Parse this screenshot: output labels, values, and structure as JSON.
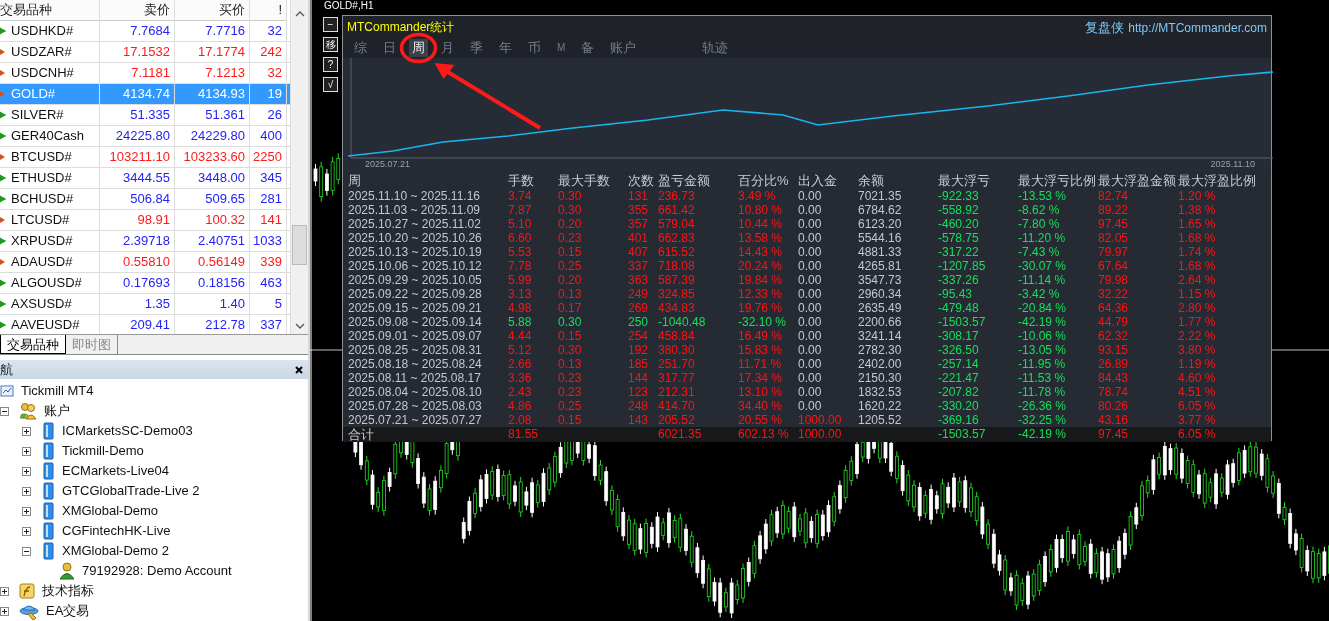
{
  "market_watch": {
    "columns": [
      "交易品种",
      "卖价",
      "买价",
      "!"
    ],
    "rows": [
      {
        "symbol": "USDHKD#",
        "bid": "7.7684",
        "ask": "7.7716",
        "spread": "32",
        "up": true,
        "selected": false
      },
      {
        "symbol": "USDZAR#",
        "bid": "17.1532",
        "ask": "17.1774",
        "spread": "242",
        "up": false,
        "selected": false
      },
      {
        "symbol": "USDCNH#",
        "bid": "7.1181",
        "ask": "7.1213",
        "spread": "32",
        "up": false,
        "selected": false
      },
      {
        "symbol": "GOLD#",
        "bid": "4134.74",
        "ask": "4134.93",
        "spread": "19",
        "up": false,
        "selected": true
      },
      {
        "symbol": "SILVER#",
        "bid": "51.335",
        "ask": "51.361",
        "spread": "26",
        "up": true,
        "selected": false
      },
      {
        "symbol": "GER40Cash",
        "bid": "24225.80",
        "ask": "24229.80",
        "spread": "400",
        "up": true,
        "selected": false
      },
      {
        "symbol": "BTCUSD#",
        "bid": "103211.10",
        "ask": "103233.60",
        "spread": "2250",
        "up": false,
        "selected": false
      },
      {
        "symbol": "ETHUSD#",
        "bid": "3444.55",
        "ask": "3448.00",
        "spread": "345",
        "up": true,
        "selected": false
      },
      {
        "symbol": "BCHUSD#",
        "bid": "506.84",
        "ask": "509.65",
        "spread": "281",
        "up": true,
        "selected": false
      },
      {
        "symbol": "LTCUSD#",
        "bid": "98.91",
        "ask": "100.32",
        "spread": "141",
        "up": false,
        "selected": false
      },
      {
        "symbol": "XRPUSD#",
        "bid": "2.39718",
        "ask": "2.40751",
        "spread": "1033",
        "up": true,
        "selected": false
      },
      {
        "symbol": "ADAUSD#",
        "bid": "0.55810",
        "ask": "0.56149",
        "spread": "339",
        "up": false,
        "selected": false
      },
      {
        "symbol": "ALGOUSD#",
        "bid": "0.17693",
        "ask": "0.18156",
        "spread": "463",
        "up": true,
        "selected": false
      },
      {
        "symbol": "AXSUSD#",
        "bid": "1.35",
        "ask": "1.40",
        "spread": "5",
        "up": true,
        "selected": false
      },
      {
        "symbol": "AAVEUSD#",
        "bid": "209.41",
        "ask": "212.78",
        "spread": "337",
        "up": true,
        "selected": false
      }
    ]
  },
  "market_tabs": [
    {
      "label": "交易品种",
      "selected": true
    },
    {
      "label": "即时图",
      "selected": false
    }
  ],
  "navigator": {
    "title": "航",
    "tree": [
      {
        "label": "Tickmill MT4",
        "kind": "terminal",
        "children": [
          {
            "label": "账户",
            "kind": "accounts",
            "expanded": true,
            "children": [
              {
                "label": "ICMarketsSC-Demo03",
                "kind": "server",
                "expanded": false
              },
              {
                "label": "Tickmill-Demo",
                "kind": "server",
                "expanded": false
              },
              {
                "label": "ECMarkets-Live04",
                "kind": "server",
                "expanded": false
              },
              {
                "label": "GTCGlobalTrade-Live 2",
                "kind": "server",
                "expanded": false
              },
              {
                "label": "XMGlobal-Demo",
                "kind": "server",
                "expanded": false
              },
              {
                "label": "CGFintechHK-Live",
                "kind": "server",
                "expanded": false
              },
              {
                "label": "XMGlobal-Demo 2",
                "kind": "server",
                "expanded": true,
                "children": [
                  {
                    "label": "79192928: Demo Account",
                    "kind": "user"
                  }
                ]
              }
            ]
          },
          {
            "label": "技术指标",
            "kind": "indicators",
            "expanded": false
          },
          {
            "label": "EA交易",
            "kind": "experts",
            "expanded": false
          }
        ]
      }
    ]
  },
  "chart_window": {
    "title": "GOLD#,H1",
    "side_buttons": [
      "−",
      "移",
      "?",
      "√"
    ]
  },
  "stats": {
    "title": "MTCommander统计",
    "brand": "复盘侠",
    "url": "http://MTCommander.com",
    "tabs": [
      {
        "label": "综",
        "selected": false
      },
      {
        "label": "日",
        "selected": false
      },
      {
        "label": "周",
        "selected": true
      },
      {
        "label": "月",
        "selected": false
      },
      {
        "label": "季",
        "selected": false
      },
      {
        "label": "年",
        "selected": false
      },
      {
        "label": "币",
        "selected": false
      },
      {
        "label": "M",
        "selected": false
      },
      {
        "label": "备",
        "selected": false
      },
      {
        "label": "账户",
        "selected": false
      },
      {
        "label": "轨迹",
        "selected": false
      }
    ],
    "chart": {
      "start_label": "2025.07.21",
      "end_label": "2025.11.10"
    },
    "table": {
      "columns": [
        "周",
        "手数",
        "最大手数",
        "次数",
        "盈亏金额",
        "百分比%",
        "出入金",
        "余额",
        "最大浮亏",
        "最大浮亏比例",
        "最大浮盈金额",
        "最大浮盈比例"
      ],
      "rows": [
        {
          "cells": [
            "2025.11.10 ~ 2025.11.16",
            "3.74",
            "0.30",
            "131",
            "236.73",
            "3.49 %",
            "0.00",
            "7021.35",
            "-922.33",
            "-13.53 %",
            "82.74",
            "1.20 %"
          ],
          "loss": false,
          "funded": false
        },
        {
          "cells": [
            "2025.11.03 ~ 2025.11.09",
            "7.87",
            "0.30",
            "355",
            "661.42",
            "10.80 %",
            "0.00",
            "6784.62",
            "-558.92",
            "-8.62 %",
            "89.22",
            "1.38 %"
          ],
          "loss": false,
          "funded": false
        },
        {
          "cells": [
            "2025.10.27 ~ 2025.11.02",
            "5.10",
            "0.20",
            "357",
            "579.04",
            "10.44 %",
            "0.00",
            "6123.20",
            "-460.20",
            "-7.80 %",
            "97.45",
            "1.65 %"
          ],
          "loss": false,
          "funded": false
        },
        {
          "cells": [
            "2025.10.20 ~ 2025.10.26",
            "6.60",
            "0.23",
            "401",
            "662.83",
            "13.58 %",
            "0.00",
            "5544.16",
            "-578.75",
            "-11.20 %",
            "82.05",
            "1.68 %"
          ],
          "loss": false,
          "funded": false
        },
        {
          "cells": [
            "2025.10.13 ~ 2025.10.19",
            "5.53",
            "0.15",
            "407",
            "615.52",
            "14.43 %",
            "0.00",
            "4881.33",
            "-317.22",
            "-7.43 %",
            "79.97",
            "1.74 %"
          ],
          "loss": false,
          "funded": false
        },
        {
          "cells": [
            "2025.10.06 ~ 2025.10.12",
            "7.78",
            "0.25",
            "337",
            "718.08",
            "20.24 %",
            "0.00",
            "4265.81",
            "-1207.85",
            "-30.07 %",
            "67.64",
            "1.68 %"
          ],
          "loss": false,
          "funded": false
        },
        {
          "cells": [
            "2025.09.29 ~ 2025.10.05",
            "5.99",
            "0.20",
            "363",
            "587.39",
            "19.84 %",
            "0.00",
            "3547.73",
            "-337.26",
            "-11.14 %",
            "79.98",
            "2.64 %"
          ],
          "loss": false,
          "funded": false
        },
        {
          "cells": [
            "2025.09.22 ~ 2025.09.28",
            "3.13",
            "0.13",
            "249",
            "324.85",
            "12.33 %",
            "0.00",
            "2960.34",
            "-95.43",
            "-3.42 %",
            "32.22",
            "1.15 %"
          ],
          "loss": false,
          "funded": false
        },
        {
          "cells": [
            "2025.09.15 ~ 2025.09.21",
            "4.98",
            "0.17",
            "269",
            "434.83",
            "19.76 %",
            "0.00",
            "2635.49",
            "-479.48",
            "-20.84 %",
            "64.36",
            "2.80 %"
          ],
          "loss": false,
          "funded": false
        },
        {
          "cells": [
            "2025.09.08 ~ 2025.09.14",
            "5.88",
            "0.30",
            "250",
            "-1040.48",
            "-32.10 %",
            "0.00",
            "2200.66",
            "-1503.57",
            "-42.19 %",
            "44.79",
            "1.77 %"
          ],
          "loss": true,
          "funded": false
        },
        {
          "cells": [
            "2025.09.01 ~ 2025.09.07",
            "4.44",
            "0.15",
            "254",
            "458.84",
            "16.49 %",
            "0.00",
            "3241.14",
            "-308.17",
            "-10.06 %",
            "62.32",
            "2.22 %"
          ],
          "loss": false,
          "funded": false
        },
        {
          "cells": [
            "2025.08.25 ~ 2025.08.31",
            "5.12",
            "0.30",
            "192",
            "380.30",
            "15.83 %",
            "0.00",
            "2782.30",
            "-326.50",
            "-13.05 %",
            "93.15",
            "3.80 %"
          ],
          "loss": false,
          "funded": false
        },
        {
          "cells": [
            "2025.08.18 ~ 2025.08.24",
            "2.66",
            "0.13",
            "185",
            "251.70",
            "11.71 %",
            "0.00",
            "2402.00",
            "-257.14",
            "-11.95 %",
            "26.89",
            "1.19 %"
          ],
          "loss": false,
          "funded": false
        },
        {
          "cells": [
            "2025.08.11 ~ 2025.08.17",
            "3.36",
            "0.23",
            "144",
            "317.77",
            "17.34 %",
            "0.00",
            "2150.30",
            "-221.47",
            "-11.53 %",
            "84.43",
            "4.60 %"
          ],
          "loss": false,
          "funded": false
        },
        {
          "cells": [
            "2025.08.04 ~ 2025.08.10",
            "2.43",
            "0.23",
            "123",
            "212.31",
            "13.10 %",
            "0.00",
            "1832.53",
            "-207.82",
            "-11.78 %",
            "78.74",
            "4.51 %"
          ],
          "loss": false,
          "funded": false
        },
        {
          "cells": [
            "2025.07.28 ~ 2025.08.03",
            "4.86",
            "0.25",
            "248",
            "414.70",
            "34.40 %",
            "0.00",
            "1620.22",
            "-330.20",
            "-26.36 %",
            "80.26",
            "6.05 %"
          ],
          "loss": false,
          "funded": false
        },
        {
          "cells": [
            "2025.07.21 ~ 2025.07.27",
            "2.08",
            "0.15",
            "143",
            "205.52",
            "20.55 %",
            "1000.00",
            "1205.52",
            "-369.16",
            "-32.25 %",
            "43.16",
            "3.77 %"
          ],
          "loss": false,
          "funded": true
        }
      ],
      "total": {
        "label": "合计",
        "lots": "81.55",
        "profit": "6021.35",
        "percent": "602.13 %",
        "deposit": "1000.00",
        "max_drawdown": "-1503.57",
        "max_drawdown_pct": "-42.19 %",
        "max_float_profit": "97.45",
        "max_float_profit_pct": "6.05 %",
        "loss": false,
        "funded": true
      }
    }
  }
}
